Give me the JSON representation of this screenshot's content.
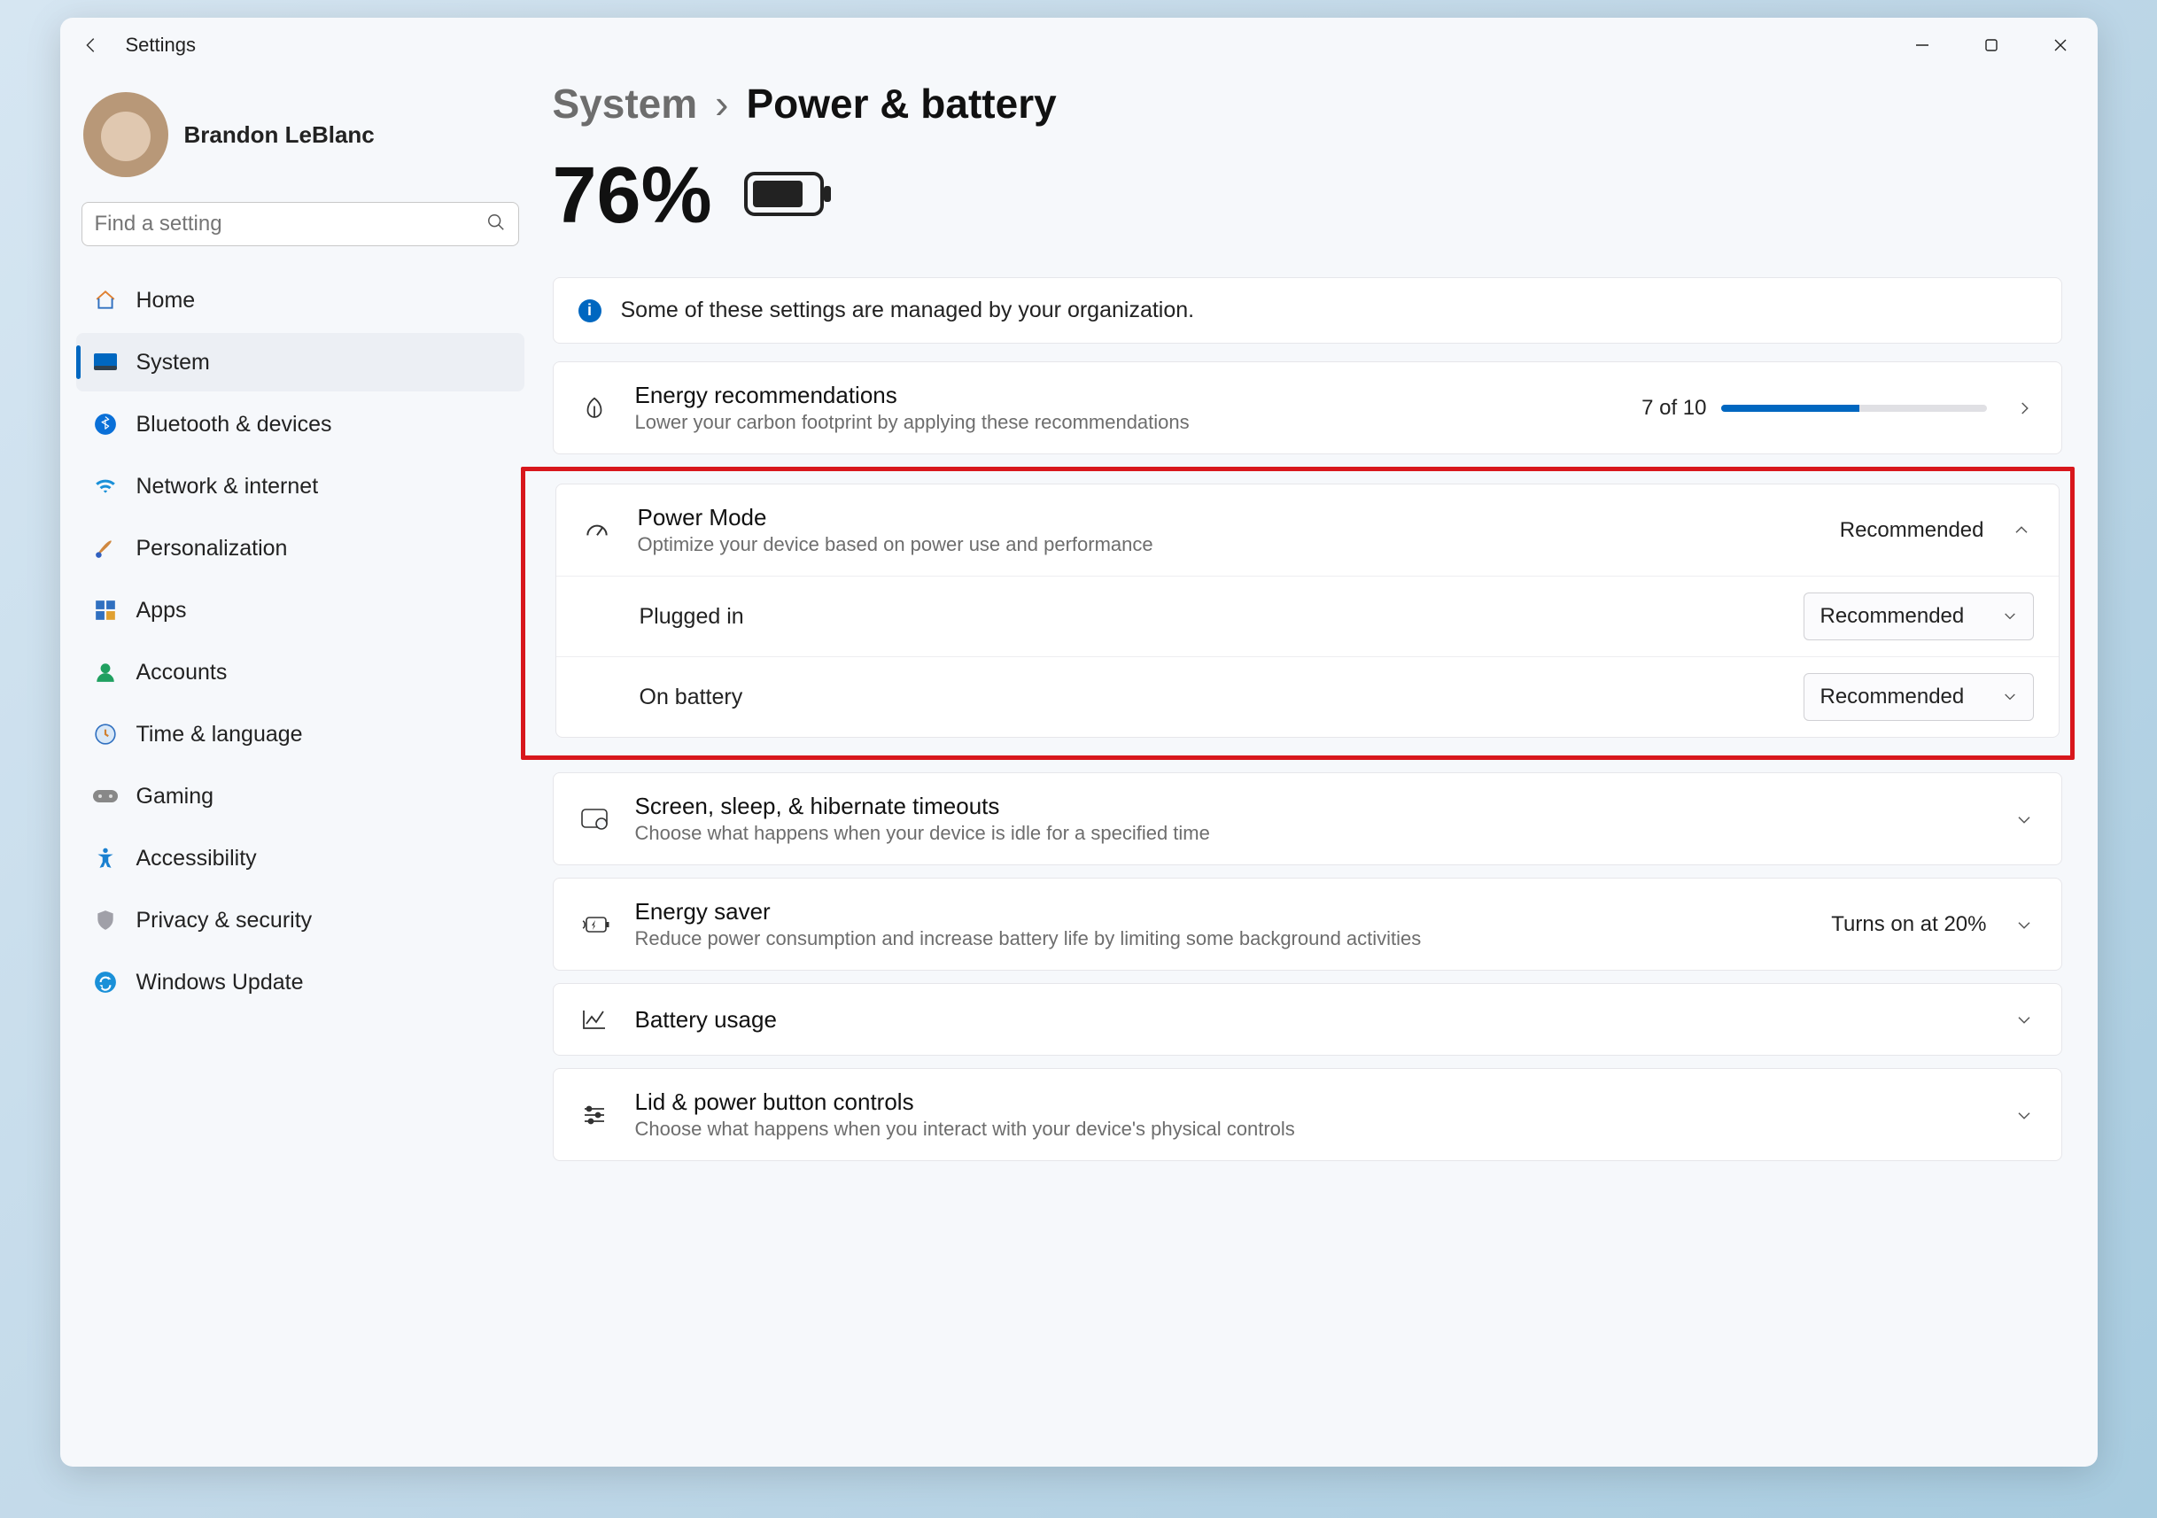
{
  "window": {
    "title": "Settings"
  },
  "user": {
    "name": "Brandon LeBlanc"
  },
  "search": {
    "placeholder": "Find a setting"
  },
  "sidebar": {
    "items": [
      {
        "label": "Home"
      },
      {
        "label": "System"
      },
      {
        "label": "Bluetooth & devices"
      },
      {
        "label": "Network & internet"
      },
      {
        "label": "Personalization"
      },
      {
        "label": "Apps"
      },
      {
        "label": "Accounts"
      },
      {
        "label": "Time & language"
      },
      {
        "label": "Gaming"
      },
      {
        "label": "Accessibility"
      },
      {
        "label": "Privacy & security"
      },
      {
        "label": "Windows Update"
      }
    ],
    "selected_index": 1
  },
  "breadcrumb": {
    "root": "System",
    "leaf": "Power & battery"
  },
  "battery": {
    "percent": "76%"
  },
  "banner": {
    "text": "Some of these settings are managed by your organization."
  },
  "energy_rec": {
    "title": "Energy recommendations",
    "subtitle": "Lower your carbon footprint by applying these recommendations",
    "progress_label": "7 of 10",
    "progress_percent": 52
  },
  "power_mode": {
    "title": "Power Mode",
    "subtitle": "Optimize your device based on power use and performance",
    "value": "Recommended",
    "plugged_label": "Plugged in",
    "plugged_value": "Recommended",
    "battery_label": "On battery",
    "battery_value": "Recommended"
  },
  "screen_sleep": {
    "title": "Screen, sleep, & hibernate timeouts",
    "subtitle": "Choose what happens when your device is idle for a specified time"
  },
  "energy_saver": {
    "title": "Energy saver",
    "subtitle": "Reduce power consumption and increase battery life by limiting some background activities",
    "value": "Turns on at 20%"
  },
  "battery_usage": {
    "title": "Battery usage"
  },
  "lid_power": {
    "title": "Lid & power button controls",
    "subtitle": "Choose what happens when you interact with your device's physical controls"
  }
}
